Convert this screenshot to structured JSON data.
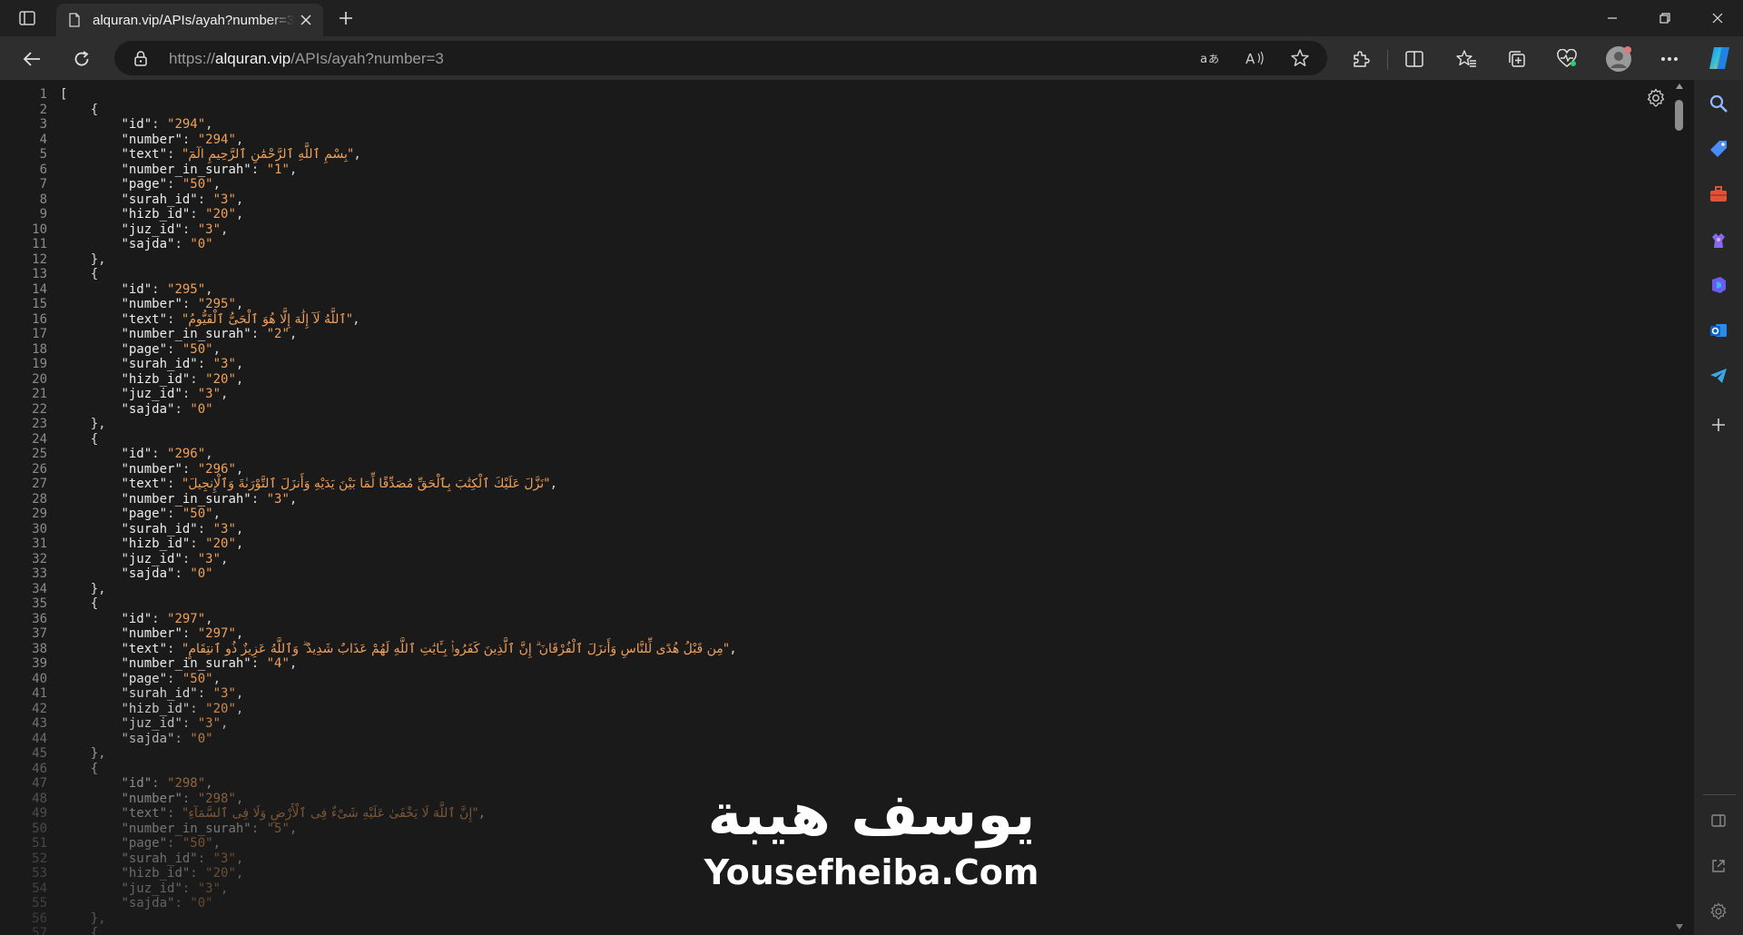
{
  "tab": {
    "title": "alquran.vip/APIs/ayah?number=3"
  },
  "address": {
    "scheme": "https://",
    "host": "alquran.vip",
    "path": "/APIs/ayah?number=3"
  },
  "json_lines": [
    {
      "n": "1",
      "parts": [
        {
          "t": "p",
          "v": "["
        }
      ]
    },
    {
      "n": "2",
      "parts": [
        {
          "t": "p",
          "v": "    {"
        }
      ]
    },
    {
      "n": "3",
      "parts": [
        {
          "t": "p",
          "v": "        "
        },
        {
          "t": "k",
          "v": "\"id\""
        },
        {
          "t": "p",
          "v": ": "
        },
        {
          "t": "s",
          "v": "\"294\""
        },
        {
          "t": "p",
          "v": ","
        }
      ]
    },
    {
      "n": "4",
      "parts": [
        {
          "t": "p",
          "v": "        "
        },
        {
          "t": "k",
          "v": "\"number\""
        },
        {
          "t": "p",
          "v": ": "
        },
        {
          "t": "s",
          "v": "\"294\""
        },
        {
          "t": "p",
          "v": ","
        }
      ]
    },
    {
      "n": "5",
      "parts": [
        {
          "t": "p",
          "v": "        "
        },
        {
          "t": "k",
          "v": "\"text\""
        },
        {
          "t": "p",
          "v": ": "
        },
        {
          "t": "sa",
          "v": "\"بِسْمِ ٱللَّهِ ٱلرَّحْمَٰنِ ٱلرَّحِيمِ الٓمٓ\""
        },
        {
          "t": "p",
          "v": ","
        }
      ]
    },
    {
      "n": "6",
      "parts": [
        {
          "t": "p",
          "v": "        "
        },
        {
          "t": "k",
          "v": "\"number_in_surah\""
        },
        {
          "t": "p",
          "v": ": "
        },
        {
          "t": "s",
          "v": "\"1\""
        },
        {
          "t": "p",
          "v": ","
        }
      ]
    },
    {
      "n": "7",
      "parts": [
        {
          "t": "p",
          "v": "        "
        },
        {
          "t": "k",
          "v": "\"page\""
        },
        {
          "t": "p",
          "v": ": "
        },
        {
          "t": "s",
          "v": "\"50\""
        },
        {
          "t": "p",
          "v": ","
        }
      ]
    },
    {
      "n": "8",
      "parts": [
        {
          "t": "p",
          "v": "        "
        },
        {
          "t": "k",
          "v": "\"surah_id\""
        },
        {
          "t": "p",
          "v": ": "
        },
        {
          "t": "s",
          "v": "\"3\""
        },
        {
          "t": "p",
          "v": ","
        }
      ]
    },
    {
      "n": "9",
      "parts": [
        {
          "t": "p",
          "v": "        "
        },
        {
          "t": "k",
          "v": "\"hizb_id\""
        },
        {
          "t": "p",
          "v": ": "
        },
        {
          "t": "s",
          "v": "\"20\""
        },
        {
          "t": "p",
          "v": ","
        }
      ]
    },
    {
      "n": "10",
      "parts": [
        {
          "t": "p",
          "v": "        "
        },
        {
          "t": "k",
          "v": "\"juz_id\""
        },
        {
          "t": "p",
          "v": ": "
        },
        {
          "t": "s",
          "v": "\"3\""
        },
        {
          "t": "p",
          "v": ","
        }
      ]
    },
    {
      "n": "11",
      "parts": [
        {
          "t": "p",
          "v": "        "
        },
        {
          "t": "k",
          "v": "\"sajda\""
        },
        {
          "t": "p",
          "v": ": "
        },
        {
          "t": "s",
          "v": "\"0\""
        }
      ]
    },
    {
      "n": "12",
      "parts": [
        {
          "t": "p",
          "v": "    },"
        }
      ]
    },
    {
      "n": "13",
      "parts": [
        {
          "t": "p",
          "v": "    {"
        }
      ]
    },
    {
      "n": "14",
      "parts": [
        {
          "t": "p",
          "v": "        "
        },
        {
          "t": "k",
          "v": "\"id\""
        },
        {
          "t": "p",
          "v": ": "
        },
        {
          "t": "s",
          "v": "\"295\""
        },
        {
          "t": "p",
          "v": ","
        }
      ]
    },
    {
      "n": "15",
      "parts": [
        {
          "t": "p",
          "v": "        "
        },
        {
          "t": "k",
          "v": "\"number\""
        },
        {
          "t": "p",
          "v": ": "
        },
        {
          "t": "s",
          "v": "\"295\""
        },
        {
          "t": "p",
          "v": ","
        }
      ]
    },
    {
      "n": "16",
      "parts": [
        {
          "t": "p",
          "v": "        "
        },
        {
          "t": "k",
          "v": "\"text\""
        },
        {
          "t": "p",
          "v": ": "
        },
        {
          "t": "sa",
          "v": "\"ٱللَّهُ لَآ إِلَٰهَ إِلَّا هُوَ ٱلْحَىُّ ٱلْقَيُّومُ\""
        },
        {
          "t": "p",
          "v": ","
        }
      ]
    },
    {
      "n": "17",
      "parts": [
        {
          "t": "p",
          "v": "        "
        },
        {
          "t": "k",
          "v": "\"number_in_surah\""
        },
        {
          "t": "p",
          "v": ": "
        },
        {
          "t": "s",
          "v": "\"2\""
        },
        {
          "t": "p",
          "v": ","
        }
      ]
    },
    {
      "n": "18",
      "parts": [
        {
          "t": "p",
          "v": "        "
        },
        {
          "t": "k",
          "v": "\"page\""
        },
        {
          "t": "p",
          "v": ": "
        },
        {
          "t": "s",
          "v": "\"50\""
        },
        {
          "t": "p",
          "v": ","
        }
      ]
    },
    {
      "n": "19",
      "parts": [
        {
          "t": "p",
          "v": "        "
        },
        {
          "t": "k",
          "v": "\"surah_id\""
        },
        {
          "t": "p",
          "v": ": "
        },
        {
          "t": "s",
          "v": "\"3\""
        },
        {
          "t": "p",
          "v": ","
        }
      ]
    },
    {
      "n": "20",
      "parts": [
        {
          "t": "p",
          "v": "        "
        },
        {
          "t": "k",
          "v": "\"hizb_id\""
        },
        {
          "t": "p",
          "v": ": "
        },
        {
          "t": "s",
          "v": "\"20\""
        },
        {
          "t": "p",
          "v": ","
        }
      ]
    },
    {
      "n": "21",
      "parts": [
        {
          "t": "p",
          "v": "        "
        },
        {
          "t": "k",
          "v": "\"juz_id\""
        },
        {
          "t": "p",
          "v": ": "
        },
        {
          "t": "s",
          "v": "\"3\""
        },
        {
          "t": "p",
          "v": ","
        }
      ]
    },
    {
      "n": "22",
      "parts": [
        {
          "t": "p",
          "v": "        "
        },
        {
          "t": "k",
          "v": "\"sajda\""
        },
        {
          "t": "p",
          "v": ": "
        },
        {
          "t": "s",
          "v": "\"0\""
        }
      ]
    },
    {
      "n": "23",
      "parts": [
        {
          "t": "p",
          "v": "    },"
        }
      ]
    },
    {
      "n": "24",
      "parts": [
        {
          "t": "p",
          "v": "    {"
        }
      ]
    },
    {
      "n": "25",
      "parts": [
        {
          "t": "p",
          "v": "        "
        },
        {
          "t": "k",
          "v": "\"id\""
        },
        {
          "t": "p",
          "v": ": "
        },
        {
          "t": "s",
          "v": "\"296\""
        },
        {
          "t": "p",
          "v": ","
        }
      ]
    },
    {
      "n": "26",
      "parts": [
        {
          "t": "p",
          "v": "        "
        },
        {
          "t": "k",
          "v": "\"number\""
        },
        {
          "t": "p",
          "v": ": "
        },
        {
          "t": "s",
          "v": "\"296\""
        },
        {
          "t": "p",
          "v": ","
        }
      ]
    },
    {
      "n": "27",
      "parts": [
        {
          "t": "p",
          "v": "        "
        },
        {
          "t": "k",
          "v": "\"text\""
        },
        {
          "t": "p",
          "v": ": "
        },
        {
          "t": "sa",
          "v": "\"نَزَّلَ عَلَيْكَ ٱلْكِتَٰبَ بِٱلْحَقِّ مُصَدِّقًا لِّمَا بَيْنَ يَدَيْهِ وَأَنزَلَ ٱلتَّوْرَىٰةَ وَٱلْإِنجِيلَ\""
        },
        {
          "t": "p",
          "v": ","
        }
      ]
    },
    {
      "n": "28",
      "parts": [
        {
          "t": "p",
          "v": "        "
        },
        {
          "t": "k",
          "v": "\"number_in_surah\""
        },
        {
          "t": "p",
          "v": ": "
        },
        {
          "t": "s",
          "v": "\"3\""
        },
        {
          "t": "p",
          "v": ","
        }
      ]
    },
    {
      "n": "29",
      "parts": [
        {
          "t": "p",
          "v": "        "
        },
        {
          "t": "k",
          "v": "\"page\""
        },
        {
          "t": "p",
          "v": ": "
        },
        {
          "t": "s",
          "v": "\"50\""
        },
        {
          "t": "p",
          "v": ","
        }
      ]
    },
    {
      "n": "30",
      "parts": [
        {
          "t": "p",
          "v": "        "
        },
        {
          "t": "k",
          "v": "\"surah_id\""
        },
        {
          "t": "p",
          "v": ": "
        },
        {
          "t": "s",
          "v": "\"3\""
        },
        {
          "t": "p",
          "v": ","
        }
      ]
    },
    {
      "n": "31",
      "parts": [
        {
          "t": "p",
          "v": "        "
        },
        {
          "t": "k",
          "v": "\"hizb_id\""
        },
        {
          "t": "p",
          "v": ": "
        },
        {
          "t": "s",
          "v": "\"20\""
        },
        {
          "t": "p",
          "v": ","
        }
      ]
    },
    {
      "n": "32",
      "parts": [
        {
          "t": "p",
          "v": "        "
        },
        {
          "t": "k",
          "v": "\"juz_id\""
        },
        {
          "t": "p",
          "v": ": "
        },
        {
          "t": "s",
          "v": "\"3\""
        },
        {
          "t": "p",
          "v": ","
        }
      ]
    },
    {
      "n": "33",
      "parts": [
        {
          "t": "p",
          "v": "        "
        },
        {
          "t": "k",
          "v": "\"sajda\""
        },
        {
          "t": "p",
          "v": ": "
        },
        {
          "t": "s",
          "v": "\"0\""
        }
      ]
    },
    {
      "n": "34",
      "parts": [
        {
          "t": "p",
          "v": "    },"
        }
      ]
    },
    {
      "n": "35",
      "parts": [
        {
          "t": "p",
          "v": "    {"
        }
      ]
    },
    {
      "n": "36",
      "parts": [
        {
          "t": "p",
          "v": "        "
        },
        {
          "t": "k",
          "v": "\"id\""
        },
        {
          "t": "p",
          "v": ": "
        },
        {
          "t": "s",
          "v": "\"297\""
        },
        {
          "t": "p",
          "v": ","
        }
      ]
    },
    {
      "n": "37",
      "parts": [
        {
          "t": "p",
          "v": "        "
        },
        {
          "t": "k",
          "v": "\"number\""
        },
        {
          "t": "p",
          "v": ": "
        },
        {
          "t": "s",
          "v": "\"297\""
        },
        {
          "t": "p",
          "v": ","
        }
      ]
    },
    {
      "n": "38",
      "parts": [
        {
          "t": "p",
          "v": "        "
        },
        {
          "t": "k",
          "v": "\"text\""
        },
        {
          "t": "p",
          "v": ": "
        },
        {
          "t": "sa",
          "v": "\"مِن قَبْلُ هُدًى لِّلنَّاسِ وَأَنزَلَ ٱلْفُرْقَانَ ۗ إِنَّ ٱلَّذِينَ كَفَرُوا۟ بِـَٔايَٰتِ ٱللَّهِ لَهُمْ عَذَابٌ شَدِيدٌ ۗ وَٱللَّهُ عَزِيزٌ ذُو ٱنتِقَامٍ\""
        },
        {
          "t": "p",
          "v": ","
        }
      ]
    },
    {
      "n": "39",
      "parts": [
        {
          "t": "p",
          "v": "        "
        },
        {
          "t": "k",
          "v": "\"number_in_surah\""
        },
        {
          "t": "p",
          "v": ": "
        },
        {
          "t": "s",
          "v": "\"4\""
        },
        {
          "t": "p",
          "v": ","
        }
      ]
    },
    {
      "n": "40",
      "parts": [
        {
          "t": "p",
          "v": "        "
        },
        {
          "t": "k",
          "v": "\"page\""
        },
        {
          "t": "p",
          "v": ": "
        },
        {
          "t": "s",
          "v": "\"50\""
        },
        {
          "t": "p",
          "v": ","
        }
      ]
    },
    {
      "n": "41",
      "parts": [
        {
          "t": "p",
          "v": "        "
        },
        {
          "t": "k",
          "v": "\"surah_id\""
        },
        {
          "t": "p",
          "v": ": "
        },
        {
          "t": "s",
          "v": "\"3\""
        },
        {
          "t": "p",
          "v": ","
        }
      ]
    },
    {
      "n": "42",
      "parts": [
        {
          "t": "p",
          "v": "        "
        },
        {
          "t": "k",
          "v": "\"hizb_id\""
        },
        {
          "t": "p",
          "v": ": "
        },
        {
          "t": "s",
          "v": "\"20\""
        },
        {
          "t": "p",
          "v": ","
        }
      ]
    },
    {
      "n": "43",
      "parts": [
        {
          "t": "p",
          "v": "        "
        },
        {
          "t": "k",
          "v": "\"juz_id\""
        },
        {
          "t": "p",
          "v": ": "
        },
        {
          "t": "s",
          "v": "\"3\""
        },
        {
          "t": "p",
          "v": ","
        }
      ]
    },
    {
      "n": "44",
      "parts": [
        {
          "t": "p",
          "v": "        "
        },
        {
          "t": "k",
          "v": "\"sajda\""
        },
        {
          "t": "p",
          "v": ": "
        },
        {
          "t": "s",
          "v": "\"0\""
        }
      ]
    },
    {
      "n": "45",
      "parts": [
        {
          "t": "p",
          "v": "    },"
        }
      ]
    },
    {
      "n": "46",
      "parts": [
        {
          "t": "p",
          "v": "    {"
        }
      ]
    },
    {
      "n": "47",
      "parts": [
        {
          "t": "p",
          "v": "        "
        },
        {
          "t": "k",
          "v": "\"id\""
        },
        {
          "t": "p",
          "v": ": "
        },
        {
          "t": "s",
          "v": "\"298\""
        },
        {
          "t": "p",
          "v": ","
        }
      ]
    },
    {
      "n": "48",
      "parts": [
        {
          "t": "p",
          "v": "        "
        },
        {
          "t": "k",
          "v": "\"number\""
        },
        {
          "t": "p",
          "v": ": "
        },
        {
          "t": "s",
          "v": "\"298\""
        },
        {
          "t": "p",
          "v": ","
        }
      ]
    },
    {
      "n": "49",
      "parts": [
        {
          "t": "p",
          "v": "        "
        },
        {
          "t": "k",
          "v": "\"text\""
        },
        {
          "t": "p",
          "v": ": "
        },
        {
          "t": "sa",
          "v": "\"إِنَّ ٱللَّهَ لَا يَخْفَىٰ عَلَيْهِ شَىْءٌ فِى ٱلْأَرْضِ وَلَا فِى ٱلسَّمَآءِ\""
        },
        {
          "t": "p",
          "v": ","
        }
      ]
    },
    {
      "n": "50",
      "parts": [
        {
          "t": "p",
          "v": "        "
        },
        {
          "t": "k",
          "v": "\"number_in_surah\""
        },
        {
          "t": "p",
          "v": ": "
        },
        {
          "t": "s",
          "v": "\"5\""
        },
        {
          "t": "p",
          "v": ","
        }
      ]
    },
    {
      "n": "51",
      "parts": [
        {
          "t": "p",
          "v": "        "
        },
        {
          "t": "k",
          "v": "\"page\""
        },
        {
          "t": "p",
          "v": ": "
        },
        {
          "t": "s",
          "v": "\"50\""
        },
        {
          "t": "p",
          "v": ","
        }
      ]
    },
    {
      "n": "52",
      "parts": [
        {
          "t": "p",
          "v": "        "
        },
        {
          "t": "k",
          "v": "\"surah_id\""
        },
        {
          "t": "p",
          "v": ": "
        },
        {
          "t": "s",
          "v": "\"3\""
        },
        {
          "t": "p",
          "v": ","
        }
      ]
    },
    {
      "n": "53",
      "parts": [
        {
          "t": "p",
          "v": "        "
        },
        {
          "t": "k",
          "v": "\"hizb_id\""
        },
        {
          "t": "p",
          "v": ": "
        },
        {
          "t": "s",
          "v": "\"20\""
        },
        {
          "t": "p",
          "v": ","
        }
      ]
    },
    {
      "n": "54",
      "parts": [
        {
          "t": "p",
          "v": "        "
        },
        {
          "t": "k",
          "v": "\"juz_id\""
        },
        {
          "t": "p",
          "v": ": "
        },
        {
          "t": "s",
          "v": "\"3\""
        },
        {
          "t": "p",
          "v": ","
        }
      ]
    },
    {
      "n": "55",
      "parts": [
        {
          "t": "p",
          "v": "        "
        },
        {
          "t": "k",
          "v": "\"sajda\""
        },
        {
          "t": "p",
          "v": ": "
        },
        {
          "t": "s",
          "v": "\"0\""
        }
      ]
    },
    {
      "n": "56",
      "parts": [
        {
          "t": "p",
          "v": "    },"
        }
      ]
    },
    {
      "n": "57",
      "parts": [
        {
          "t": "p",
          "v": "    {"
        }
      ]
    }
  ],
  "watermark": {
    "arabic": "يوسف هيبة",
    "latin": "Yousefheiba.Com"
  },
  "icons": {
    "tab_actions": "tab-actions-icon",
    "favicon": "page-icon",
    "tab_close": "close-icon",
    "new_tab": "plus-icon",
    "minimize": "minimize-icon",
    "restore": "restore-icon",
    "close_window": "close-icon",
    "back": "back-arrow-icon",
    "refresh": "refresh-icon",
    "lock": "lock-icon",
    "translate": "translate-icon",
    "read_aloud": "read-aloud-icon",
    "favorite": "star-icon",
    "extensions": "puzzle-icon",
    "split_screen": "split-screen-icon",
    "favorites": "favorites-icon",
    "collections": "collections-icon",
    "performance": "heart-pulse-icon",
    "profile": "avatar-icon",
    "more": "more-icon",
    "copilot": "copilot-icon",
    "sidebar": [
      "search-icon",
      "shopping-tag-icon",
      "tools-icon",
      "games-icon",
      "office-icon",
      "outlook-icon",
      "telegram-icon",
      "add-icon"
    ]
  },
  "colors": {
    "json_key": "#ececec",
    "json_string": "#f0a05a",
    "line_number": "#8b8b8b",
    "background": "#1a1a1a",
    "toolbar": "#2e2e2e"
  }
}
